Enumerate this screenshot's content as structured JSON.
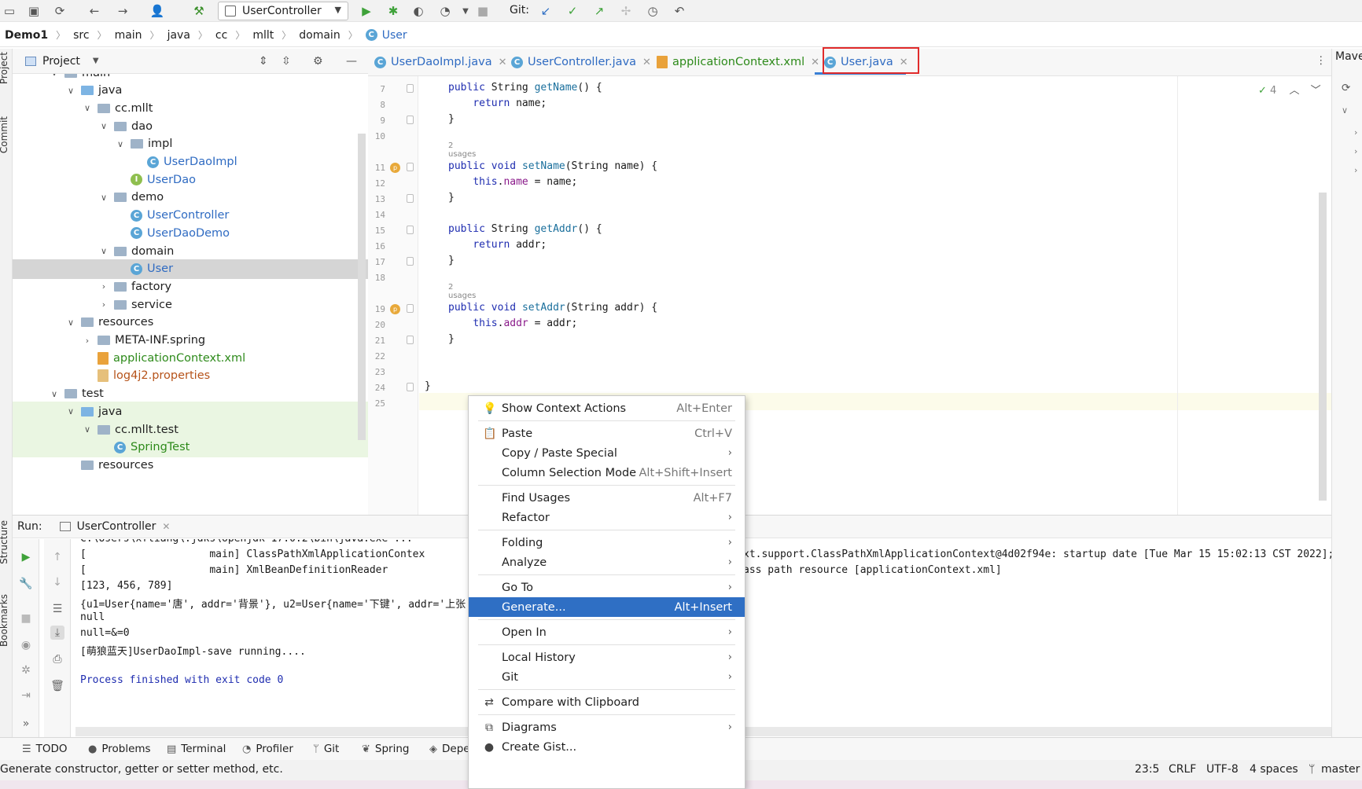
{
  "toolbar": {
    "run_config": "UserController",
    "git_label": "Git:"
  },
  "breadcrumb": [
    "Demo1",
    "src",
    "main",
    "java",
    "cc",
    "mllt",
    "domain",
    "User"
  ],
  "left_strip": {
    "project": "Project",
    "commit": "Commit",
    "structure": "Structure",
    "bookmarks": "Bookmarks"
  },
  "project_pane": {
    "title": "Project",
    "tree": [
      {
        "label": "main",
        "depth": 0,
        "arrow": "v",
        "kind": "folder"
      },
      {
        "label": "java",
        "depth": 1,
        "arrow": "v",
        "kind": "folder-blue"
      },
      {
        "label": "cc.mllt",
        "depth": 2,
        "arrow": "v",
        "kind": "folder"
      },
      {
        "label": "dao",
        "depth": 3,
        "arrow": "v",
        "kind": "folder"
      },
      {
        "label": "impl",
        "depth": 4,
        "arrow": "v",
        "kind": "folder"
      },
      {
        "label": "UserDaoImpl",
        "depth": 5,
        "arrow": "",
        "kind": "class",
        "color": "blue"
      },
      {
        "label": "UserDao",
        "depth": 4,
        "arrow": "",
        "kind": "interface",
        "color": "blue"
      },
      {
        "label": "demo",
        "depth": 3,
        "arrow": "v",
        "kind": "folder"
      },
      {
        "label": "UserController",
        "depth": 4,
        "arrow": "",
        "kind": "class",
        "color": "blue"
      },
      {
        "label": "UserDaoDemo",
        "depth": 4,
        "arrow": "",
        "kind": "class",
        "color": "blue"
      },
      {
        "label": "domain",
        "depth": 3,
        "arrow": "v",
        "kind": "folder"
      },
      {
        "label": "User",
        "depth": 4,
        "arrow": "",
        "kind": "class",
        "color": "blue",
        "selected": true
      },
      {
        "label": "factory",
        "depth": 3,
        "arrow": ">",
        "kind": "folder"
      },
      {
        "label": "service",
        "depth": 3,
        "arrow": ">",
        "kind": "folder"
      },
      {
        "label": "resources",
        "depth": 1,
        "arrow": "v",
        "kind": "folder"
      },
      {
        "label": "META-INF.spring",
        "depth": 2,
        "arrow": ">",
        "kind": "folder"
      },
      {
        "label": "applicationContext.xml",
        "depth": 2,
        "arrow": "",
        "kind": "xml",
        "color": "green"
      },
      {
        "label": "log4j2.properties",
        "depth": 2,
        "arrow": "",
        "kind": "prop",
        "color": "orange"
      },
      {
        "label": "test",
        "depth": 0,
        "arrow": "v",
        "kind": "folder"
      },
      {
        "label": "java",
        "depth": 1,
        "arrow": "v",
        "kind": "folder-green",
        "test": true
      },
      {
        "label": "cc.mllt.test",
        "depth": 2,
        "arrow": "v",
        "kind": "folder",
        "test": true
      },
      {
        "label": "SpringTest",
        "depth": 3,
        "arrow": "",
        "kind": "class",
        "color": "green",
        "test": true
      },
      {
        "label": "resources",
        "depth": 1,
        "arrow": "",
        "kind": "folder"
      }
    ]
  },
  "editor_tabs": [
    {
      "label": "UserDaoImpl.java",
      "color": "blue"
    },
    {
      "label": "UserController.java",
      "color": "blue"
    },
    {
      "label": "applicationContext.xml",
      "color": "green"
    },
    {
      "label": "User.java",
      "color": "blue",
      "active": true
    }
  ],
  "inspection_count": "4",
  "code_lines": [
    {
      "n": "7",
      "text": "    public String getName() {"
    },
    {
      "n": "8",
      "text": "        return name;"
    },
    {
      "n": "9",
      "text": "    }"
    },
    {
      "n": "10",
      "text": ""
    },
    {
      "n": "11",
      "text": "    public void setName(String name) {",
      "usages": "2 usages"
    },
    {
      "n": "12",
      "text": "        this.name = name;"
    },
    {
      "n": "13",
      "text": "    }"
    },
    {
      "n": "14",
      "text": ""
    },
    {
      "n": "15",
      "text": "    public String getAddr() {"
    },
    {
      "n": "16",
      "text": "        return addr;"
    },
    {
      "n": "17",
      "text": "    }"
    },
    {
      "n": "18",
      "text": ""
    },
    {
      "n": "19",
      "text": "    public void setAddr(String addr) {",
      "usages": "2 usages"
    },
    {
      "n": "20",
      "text": "        this.addr = addr;"
    },
    {
      "n": "21",
      "text": "    }"
    },
    {
      "n": "22",
      "text": ""
    },
    {
      "n": "23",
      "text": ""
    },
    {
      "n": "24",
      "text": "}"
    },
    {
      "n": "25",
      "text": ""
    }
  ],
  "run_panel": {
    "label": "Run:",
    "tab": "UserController",
    "console": [
      "C:\\Users\\xfliang\\.jdks\\openjdk-17.0.2\\bin\\java.exe ...",
      "[                    main] ClassPathXmlApplicationContex",
      "[                    main] XmlBeanDefinitionReader",
      "[123, 456, 789]",
      "{u1=User{name='唐', addr='背景'}, u2=User{name='下键', addr='上张",
      "null",
      "null=&=0",
      "[萌狼蓝天]UserDaoImpl-save running....",
      "",
      "Process finished with exit code 0"
    ],
    "console_right": [
      "xt.support.ClassPathXmlApplicationContext@4d02f94e: startup date [Tue Mar 15 15:02:13 CST 2022]; r",
      "ass path resource [applicationContext.xml]"
    ]
  },
  "bottom_tabs": [
    "TODO",
    "Problems",
    "Terminal",
    "Profiler",
    "Git",
    "Spring",
    "Depe"
  ],
  "status": {
    "message": "Generate constructor, getter or setter method, etc.",
    "position": "23:5",
    "line_sep": "CRLF",
    "encoding": "UTF-8",
    "indent": "4 spaces",
    "branch": "master"
  },
  "right_strip": {
    "maven": "Mave"
  },
  "context_menu": [
    {
      "label": "Show Context Actions",
      "shortcut": "Alt+Enter",
      "icon": "bulb-icon"
    },
    {
      "sep": true
    },
    {
      "label": "Paste",
      "shortcut": "Ctrl+V",
      "icon": "clipboard-icon"
    },
    {
      "label": "Copy / Paste Special",
      "submenu": true
    },
    {
      "label": "Column Selection Mode",
      "shortcut": "Alt+Shift+Insert"
    },
    {
      "sep": true
    },
    {
      "label": "Find Usages",
      "shortcut": "Alt+F7"
    },
    {
      "label": "Refactor",
      "submenu": true
    },
    {
      "sep": true
    },
    {
      "label": "Folding",
      "submenu": true
    },
    {
      "label": "Analyze",
      "submenu": true
    },
    {
      "sep": true
    },
    {
      "label": "Go To",
      "submenu": true
    },
    {
      "label": "Generate...",
      "shortcut": "Alt+Insert",
      "selected": true
    },
    {
      "sep": true
    },
    {
      "label": "Open In",
      "submenu": true
    },
    {
      "sep": true
    },
    {
      "label": "Local History",
      "submenu": true
    },
    {
      "label": "Git",
      "submenu": true
    },
    {
      "sep": true
    },
    {
      "label": "Compare with Clipboard",
      "icon": "compare-icon"
    },
    {
      "sep": true
    },
    {
      "label": "Diagrams",
      "submenu": true,
      "icon": "diagram-icon"
    },
    {
      "label": "Create Gist...",
      "icon": "github-icon"
    }
  ]
}
